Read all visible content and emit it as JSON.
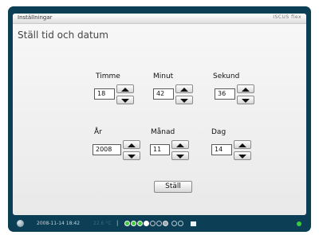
{
  "window": {
    "title": "Inställningar",
    "logo": "ISCUS flex"
  },
  "page": {
    "heading": "Ställ tid och datum"
  },
  "fields": {
    "hour": {
      "label": "Timme",
      "value": "18"
    },
    "minute": {
      "label": "Minut",
      "value": "42"
    },
    "second": {
      "label": "Sekund",
      "value": "36"
    },
    "year": {
      "label": "År",
      "value": "2008"
    },
    "month": {
      "label": "Månad",
      "value": "11"
    },
    "day": {
      "label": "Dag",
      "value": "14"
    }
  },
  "actions": {
    "set_label": "Ställ"
  },
  "status": {
    "datetime": "2008-11-14 18:42",
    "temperature": "22.6 °C",
    "separator": "|",
    "indicator_color": "#3acb3a"
  }
}
